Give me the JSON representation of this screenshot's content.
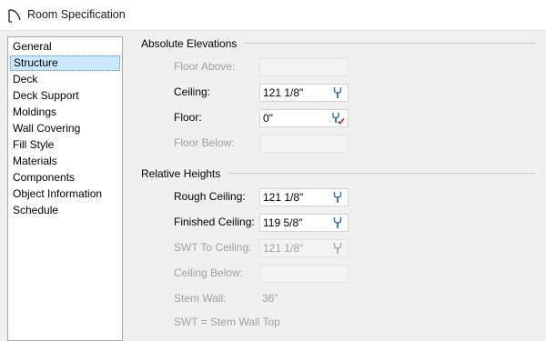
{
  "window": {
    "title": "Room Specification"
  },
  "sidebar": {
    "items": [
      {
        "label": "General"
      },
      {
        "label": "Structure",
        "selected": true
      },
      {
        "label": "Deck"
      },
      {
        "label": "Deck Support"
      },
      {
        "label": "Moldings"
      },
      {
        "label": "Wall Covering"
      },
      {
        "label": "Fill Style"
      },
      {
        "label": "Materials"
      },
      {
        "label": "Components"
      },
      {
        "label": "Object Information"
      },
      {
        "label": "Schedule"
      }
    ]
  },
  "absolute_elevations": {
    "header": "Absolute Elevations",
    "floor_above": {
      "label": "Floor Above:",
      "value": "",
      "enabled": false
    },
    "ceiling": {
      "label": "Ceiling:",
      "value": "121 1/8\"",
      "enabled": true,
      "icon": "wrench-icon"
    },
    "floor": {
      "label": "Floor:",
      "value": "0\"",
      "enabled": true,
      "icon": "wrench-check-icon"
    },
    "floor_below": {
      "label": "Floor Below:",
      "value": "",
      "enabled": false
    }
  },
  "relative_heights": {
    "header": "Relative Heights",
    "rough_ceiling": {
      "label": "Rough Ceiling:",
      "value": "121 1/8\"",
      "enabled": true,
      "icon": "wrench-icon"
    },
    "finished_ceiling": {
      "label": "Finished Ceiling:",
      "value": "119 5/8\"",
      "enabled": true,
      "icon": "wrench-icon"
    },
    "swt_to_ceiling": {
      "label": "SWT To Ceiling:",
      "value": "121 1/8\"",
      "enabled": false,
      "icon": "wrench-icon"
    },
    "ceiling_below": {
      "label": "Ceiling Below:",
      "value": "",
      "enabled": false
    },
    "stem_wall": {
      "label": "Stem Wall:",
      "value": "36\"",
      "enabled": false
    },
    "note": "SWT = Stem Wall Top"
  },
  "colors": {
    "selection": "#cce8ff",
    "disabled_text": "#a0a0a0",
    "check_accent": "#c0282d"
  }
}
